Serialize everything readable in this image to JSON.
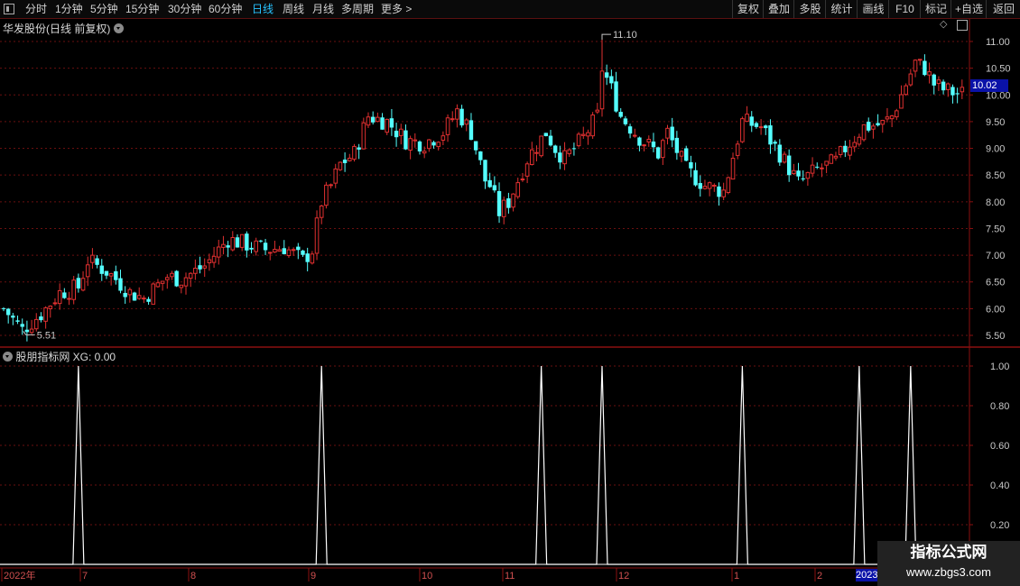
{
  "toolbar": {
    "periods": [
      "分时",
      "1分钟",
      "5分钟",
      "15分钟",
      "30分钟",
      "60分钟",
      "日线",
      "周线",
      "月线",
      "多周期",
      "更多 >"
    ],
    "active_period": "日线",
    "right_buttons": [
      "复权",
      "叠加",
      "多股",
      "统计",
      "画线",
      "F10",
      "标记",
      "+自选",
      "返回"
    ]
  },
  "main_panel": {
    "title": "华发股份(日线 前复权)",
    "price_axis": [
      "11.00",
      "10.50",
      "10.00",
      "9.50",
      "9.00",
      "8.50",
      "8.00",
      "7.50",
      "7.00",
      "6.50",
      "6.00",
      "5.50"
    ],
    "current_price": "10.02",
    "high_label": "11.10",
    "low_label": "5.51"
  },
  "indicator_panel": {
    "title": "股朋指标网 XG: 0.00",
    "axis": [
      "1.00",
      "0.80",
      "0.60",
      "0.40",
      "0.20"
    ]
  },
  "date_axis": {
    "labels": [
      "2022年",
      "7",
      "8",
      "9",
      "10",
      "11",
      "12",
      "1",
      "2"
    ],
    "highlight": "2023"
  },
  "watermark": {
    "title": "指标公式网",
    "url": "www.zbgs3.com"
  },
  "colors": {
    "up": "#e03030",
    "down": "#54ffff",
    "grid": "#6a0f0f",
    "border": "#8b1010",
    "active": "#27c3ff"
  },
  "chart_data": [
    {
      "type": "candlestick",
      "title": "华发股份(日线 前复权)",
      "y_ticks": [
        5.5,
        6.0,
        6.5,
        7.0,
        7.5,
        8.0,
        8.5,
        9.0,
        9.5,
        10.0,
        10.5,
        11.0
      ],
      "ylim": [
        5.3,
        11.3
      ],
      "annotations": {
        "high": 11.1,
        "low": 5.51,
        "last": 10.02
      },
      "close_path": [
        [
          0,
          6.0
        ],
        [
          4,
          5.6
        ],
        [
          8,
          5.9
        ],
        [
          12,
          6.3
        ],
        [
          16,
          6.4
        ],
        [
          18,
          6.9
        ],
        [
          22,
          6.7
        ],
        [
          24,
          6.55
        ],
        [
          27,
          6.3
        ],
        [
          30,
          6.2
        ],
        [
          35,
          6.6
        ],
        [
          38,
          6.55
        ],
        [
          43,
          6.8
        ],
        [
          48,
          7.3
        ],
        [
          52,
          7.2
        ],
        [
          56,
          7.1
        ],
        [
          60,
          7.15
        ],
        [
          64,
          6.9
        ],
        [
          66,
          7.1
        ],
        [
          68,
          8.0
        ],
        [
          70,
          8.3
        ],
        [
          72,
          8.7
        ],
        [
          75,
          8.9
        ],
        [
          78,
          9.6
        ],
        [
          82,
          9.5
        ],
        [
          86,
          9.15
        ],
        [
          90,
          9.1
        ],
        [
          94,
          9.3
        ],
        [
          97,
          9.7
        ],
        [
          100,
          9.3
        ],
        [
          103,
          8.4
        ],
        [
          104,
          8.3
        ],
        [
          106,
          7.8
        ],
        [
          108,
          8.0
        ],
        [
          112,
          8.8
        ],
        [
          116,
          9.3
        ],
        [
          118,
          9.0
        ],
        [
          120,
          8.8
        ],
        [
          124,
          9.2
        ],
        [
          127,
          9.6
        ],
        [
          128,
          10.5
        ],
        [
          130,
          10.1
        ],
        [
          132,
          9.6
        ],
        [
          136,
          9.2
        ],
        [
          140,
          8.9
        ],
        [
          142,
          9.3
        ],
        [
          146,
          8.6
        ],
        [
          150,
          8.3
        ],
        [
          154,
          8.2
        ],
        [
          158,
          9.5
        ],
        [
          162,
          9.4
        ],
        [
          166,
          8.9
        ],
        [
          170,
          8.35
        ],
        [
          174,
          8.6
        ],
        [
          178,
          8.75
        ],
        [
          180,
          9.0
        ],
        [
          184,
          9.4
        ],
        [
          188,
          9.45
        ],
        [
          190,
          9.6
        ],
        [
          193,
          10.2
        ],
        [
          195,
          10.6
        ],
        [
          197,
          10.5
        ],
        [
          199,
          10.2
        ],
        [
          201,
          10.1
        ],
        [
          204,
          10.02
        ]
      ]
    },
    {
      "type": "line",
      "title": "股朋指标网 XG: 0.00",
      "name": "XG",
      "y_ticks": [
        0.2,
        0.4,
        0.6,
        0.8,
        1.0
      ],
      "ylim": [
        0,
        1.05
      ],
      "signal_bars": [
        16,
        68,
        115,
        128,
        158,
        183,
        194
      ]
    }
  ]
}
